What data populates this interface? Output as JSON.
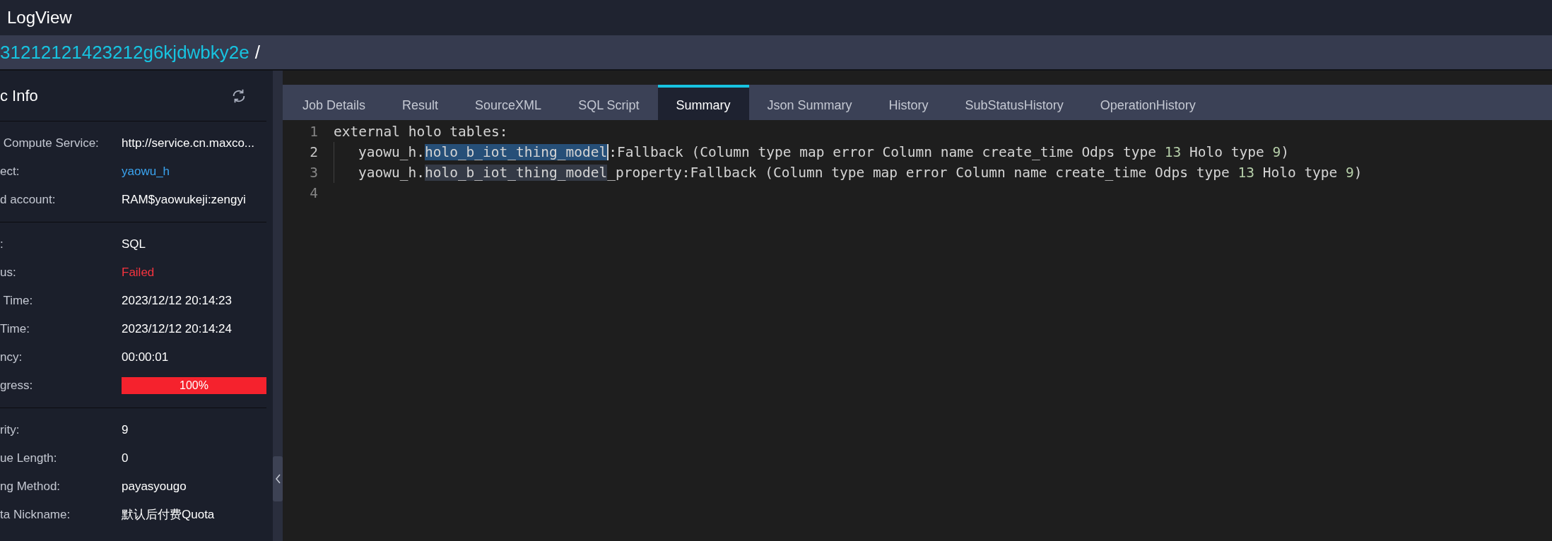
{
  "window": {
    "title": "LogView"
  },
  "breadcrumb": {
    "job_id": "31212121423212g6kjdwbky2e",
    "separator": "/"
  },
  "basic_info": {
    "title": "c Info",
    "sections": [
      [
        {
          "label": " Compute Service:",
          "value": "http://service.cn.maxco...",
          "kind": "text"
        },
        {
          "label": "ect:",
          "value": "yaowu_h",
          "kind": "link"
        },
        {
          "label": "d account:",
          "value": "RAM$yaowukeji:zengyi",
          "kind": "text"
        }
      ],
      [
        {
          "label": ":",
          "value": "SQL",
          "kind": "text"
        },
        {
          "label": "us:",
          "value": "Failed",
          "kind": "error"
        },
        {
          "label": " Time:",
          "value": "2023/12/12 20:14:23",
          "kind": "text"
        },
        {
          "label": "Time:",
          "value": "2023/12/12 20:14:24",
          "kind": "text"
        },
        {
          "label": "ncy:",
          "value": "00:00:01",
          "kind": "text"
        },
        {
          "label": "gress:",
          "value": "100%",
          "kind": "progress",
          "level": 1
        }
      ],
      [
        {
          "label": "rity:",
          "value": "9",
          "kind": "text"
        },
        {
          "label": "ue Length:",
          "value": "0",
          "kind": "text"
        },
        {
          "label": "ng Method:",
          "value": "payasyougo",
          "kind": "text"
        },
        {
          "label": "ta Nickname:",
          "value": "默认后付费Quota",
          "kind": "text"
        }
      ]
    ]
  },
  "tabs": [
    {
      "label": "Job Details",
      "selected": false
    },
    {
      "label": "Result",
      "selected": false
    },
    {
      "label": "SourceXML",
      "selected": false
    },
    {
      "label": "SQL Script",
      "selected": false
    },
    {
      "label": "Summary",
      "selected": true
    },
    {
      "label": "Json Summary",
      "selected": false
    },
    {
      "label": "History",
      "selected": false
    },
    {
      "label": "SubStatusHistory",
      "selected": false
    },
    {
      "label": "OperationHistory",
      "selected": false
    }
  ],
  "editor": {
    "lines": [
      {
        "number": "1",
        "active": false,
        "indent": false,
        "segments": [
          {
            "text": "external holo tables:",
            "kind": "plain"
          }
        ]
      },
      {
        "number": "2",
        "active": true,
        "indent": true,
        "segments": [
          {
            "text": "yaowu_h.",
            "kind": "plain"
          },
          {
            "text": "holo_b_iot_thing_model",
            "kind": "selection"
          },
          {
            "text": ":Fallback (Column type map error Column name create_time Odps type ",
            "kind": "plain"
          },
          {
            "text": "13",
            "kind": "number"
          },
          {
            "text": " Holo type ",
            "kind": "plain"
          },
          {
            "text": "9",
            "kind": "number"
          },
          {
            "text": ")",
            "kind": "plain"
          }
        ]
      },
      {
        "number": "3",
        "active": false,
        "indent": true,
        "segments": [
          {
            "text": "yaowu_h.",
            "kind": "plain"
          },
          {
            "text": "holo_b_iot_thing_model",
            "kind": "match"
          },
          {
            "text": "_property:Fallback (Column type map error Column name create_time Odps type ",
            "kind": "plain"
          },
          {
            "text": "13",
            "kind": "number"
          },
          {
            "text": " Holo type ",
            "kind": "plain"
          },
          {
            "text": "9",
            "kind": "number"
          },
          {
            "text": ")",
            "kind": "plain"
          }
        ]
      },
      {
        "number": "4",
        "active": false,
        "indent": false
      }
    ]
  }
}
